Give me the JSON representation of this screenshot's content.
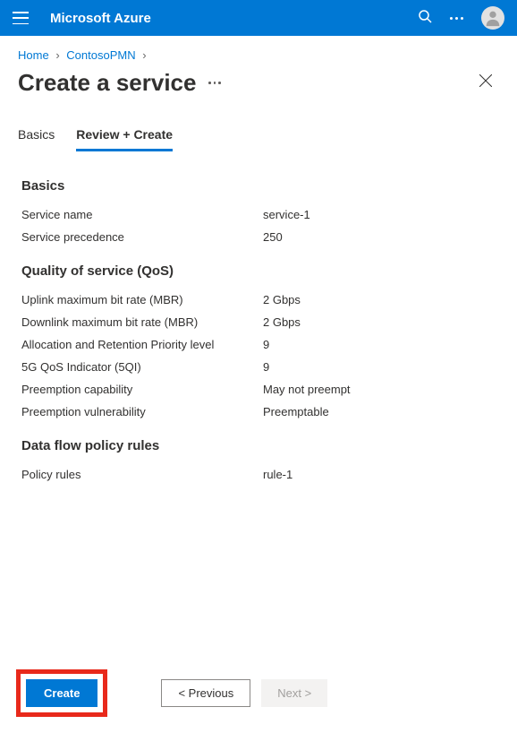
{
  "header": {
    "brand": "Microsoft Azure"
  },
  "breadcrumb": {
    "items": [
      "Home",
      "ContosoPMN"
    ]
  },
  "page": {
    "title": "Create a service"
  },
  "tabs": {
    "items": [
      {
        "label": "Basics",
        "active": false
      },
      {
        "label": "Review + Create",
        "active": true
      }
    ]
  },
  "sections": {
    "basics": {
      "title": "Basics",
      "fields": [
        {
          "label": "Service name",
          "value": "service-1"
        },
        {
          "label": "Service precedence",
          "value": "250"
        }
      ]
    },
    "qos": {
      "title": "Quality of service (QoS)",
      "fields": [
        {
          "label": "Uplink maximum bit rate (MBR)",
          "value": "2 Gbps"
        },
        {
          "label": "Downlink maximum bit rate (MBR)",
          "value": "2 Gbps"
        },
        {
          "label": "Allocation and Retention Priority level",
          "value": "9"
        },
        {
          "label": "5G QoS Indicator (5QI)",
          "value": "9"
        },
        {
          "label": "Preemption capability",
          "value": "May not preempt"
        },
        {
          "label": "Preemption vulnerability",
          "value": "Preemptable"
        }
      ]
    },
    "rules": {
      "title": "Data flow policy rules",
      "fields": [
        {
          "label": "Policy rules",
          "value": "rule-1"
        }
      ]
    }
  },
  "footer": {
    "create": "Create",
    "previous": "< Previous",
    "next": "Next >"
  }
}
